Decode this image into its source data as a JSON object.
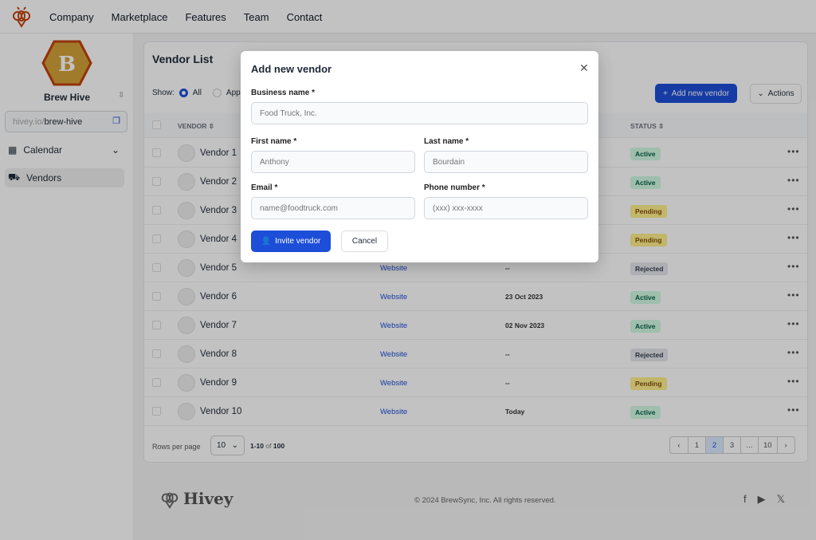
{
  "nav": {
    "items": [
      "Company",
      "Marketplace",
      "Features",
      "Team",
      "Contact"
    ]
  },
  "sidebar": {
    "brand_letter": "B",
    "brand_name": "Brew Hive",
    "url_prefix": "hivey.io/",
    "url_slug": "brew-hive",
    "items": [
      {
        "label": "Calendar",
        "icon": "calendar-icon"
      },
      {
        "label": "Vendors",
        "icon": "truck-icon"
      }
    ]
  },
  "card": {
    "title": "Vendor List",
    "show_label": "Show:",
    "filters": [
      "All",
      "App"
    ],
    "add_label": "Add new vendor",
    "actions_label": "Actions",
    "columns": {
      "vendor": "VENDOR",
      "status": "STATUS"
    },
    "rows": [
      {
        "name": "Vendor 1",
        "website": "",
        "date": "",
        "status": "Active"
      },
      {
        "name": "Vendor 2",
        "website": "",
        "date": "",
        "status": "Active"
      },
      {
        "name": "Vendor 3",
        "website": "",
        "date": "",
        "status": "Pending"
      },
      {
        "name": "Vendor 4",
        "website": "",
        "date": "",
        "status": "Pending"
      },
      {
        "name": "Vendor 5",
        "website": "Website",
        "date": "--",
        "status": "Rejected"
      },
      {
        "name": "Vendor 6",
        "website": "Website",
        "date": "23 Oct 2023",
        "status": "Active"
      },
      {
        "name": "Vendor 7",
        "website": "Website",
        "date": "02 Nov 2023",
        "status": "Active"
      },
      {
        "name": "Vendor 8",
        "website": "Website",
        "date": "--",
        "status": "Rejected"
      },
      {
        "name": "Vendor 9",
        "website": "Website",
        "date": "--",
        "status": "Pending"
      },
      {
        "name": "Vendor 10",
        "website": "Website",
        "date": "Today",
        "status": "Active"
      }
    ],
    "rows_per_page_label": "Rows per page",
    "rows_per_page": "10",
    "range": "1-10",
    "of": "of",
    "total": "100",
    "pages": [
      "‹",
      "1",
      "2",
      "3",
      "...",
      "10",
      "›"
    ],
    "current_page": "2"
  },
  "footer": {
    "logo": "Hivey",
    "copyright": "© 2024 BrewSync, Inc. All rights reserved.",
    "social": [
      "facebook-icon",
      "youtube-icon",
      "x-icon"
    ]
  },
  "modal": {
    "title": "Add new vendor",
    "business_label": "Business name *",
    "business_placeholder": "Food Truck, Inc.",
    "first_label": "First name *",
    "first_placeholder": "Anthony",
    "last_label": "Last name *",
    "last_placeholder": "Bourdain",
    "email_label": "Email *",
    "email_placeholder": "name@foodtruck.com",
    "phone_label": "Phone number *",
    "phone_placeholder": "(xxx) xxx-xxxx",
    "invite_label": "Invite vendor",
    "cancel_label": "Cancel"
  },
  "colors": {
    "accent": "#1d4ed8",
    "brand": "#c2410c",
    "brand_gold": "#d4a23a"
  }
}
